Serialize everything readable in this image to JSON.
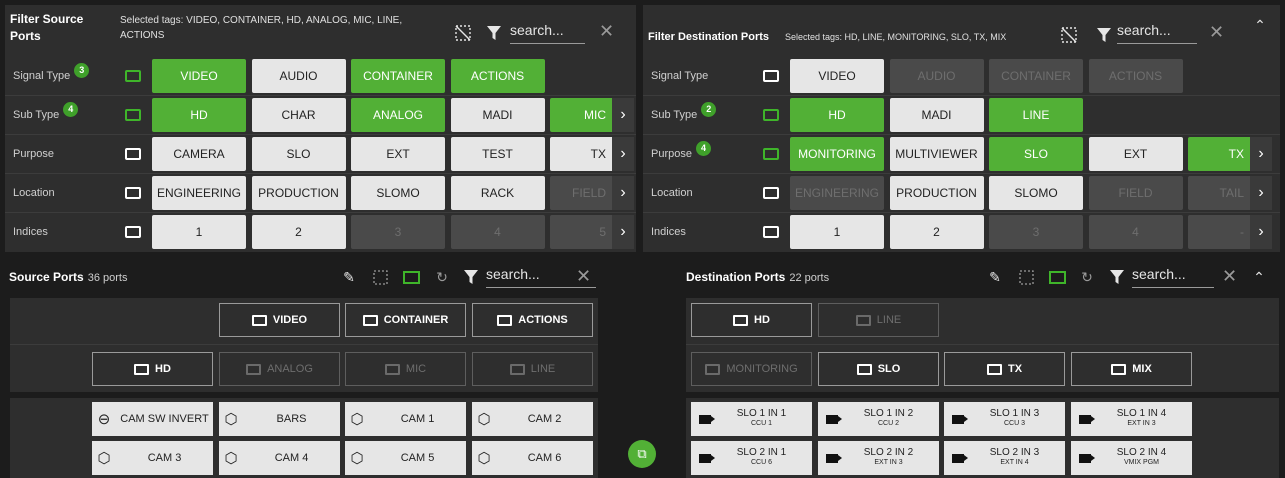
{
  "source_filter": {
    "title": "Filter Source Ports",
    "selected_tags": "Selected tags: VIDEO, CONTAINER, HD, ANALOG, MIC, LINE, ACTIONS",
    "search_placeholder": "search...",
    "rows": [
      {
        "label": "Signal Type",
        "badge": "3",
        "folder_active": true,
        "chips": [
          {
            "t": "VIDEO",
            "s": "g"
          },
          {
            "t": "AUDIO",
            "s": "w"
          },
          {
            "t": "CONTAINER",
            "s": "g"
          },
          {
            "t": "ACTIONS",
            "s": "g"
          }
        ]
      },
      {
        "label": "Sub Type",
        "badge": "4",
        "folder_active": true,
        "chips": [
          {
            "t": "HD",
            "s": "g"
          },
          {
            "t": "CHAR",
            "s": "w"
          },
          {
            "t": "ANALOG",
            "s": "g"
          },
          {
            "t": "MADI",
            "s": "w"
          },
          {
            "t": "MIC",
            "s": "g"
          }
        ]
      },
      {
        "label": "Purpose",
        "badge": "",
        "folder_active": false,
        "chips": [
          {
            "t": "CAMERA",
            "s": "w"
          },
          {
            "t": "SLO",
            "s": "w"
          },
          {
            "t": "EXT",
            "s": "w"
          },
          {
            "t": "TEST",
            "s": "w"
          },
          {
            "t": "TX",
            "s": "w"
          }
        ]
      },
      {
        "label": "Location",
        "badge": "",
        "folder_active": false,
        "chips": [
          {
            "t": "ENGINEERING",
            "s": "w"
          },
          {
            "t": "PRODUCTION",
            "s": "w"
          },
          {
            "t": "SLOMO",
            "s": "w"
          },
          {
            "t": "RACK",
            "s": "w"
          },
          {
            "t": "FIELD",
            "s": "d"
          }
        ]
      },
      {
        "label": "Indices",
        "badge": "",
        "folder_active": false,
        "chips": [
          {
            "t": "1",
            "s": "w"
          },
          {
            "t": "2",
            "s": "w"
          },
          {
            "t": "3",
            "s": "d"
          },
          {
            "t": "4",
            "s": "d"
          },
          {
            "t": "5",
            "s": "d"
          }
        ]
      }
    ]
  },
  "dest_filter": {
    "title": "Filter Destination Ports",
    "selected_tags": "Selected tags: HD, LINE, MONITORING, SLO, TX, MIX",
    "search_placeholder": "search...",
    "rows": [
      {
        "label": "Signal Type",
        "badge": "",
        "folder_active": false,
        "chips": [
          {
            "t": "VIDEO",
            "s": "w"
          },
          {
            "t": "AUDIO",
            "s": "d"
          },
          {
            "t": "CONTAINER",
            "s": "d"
          },
          {
            "t": "ACTIONS",
            "s": "d"
          }
        ]
      },
      {
        "label": "Sub Type",
        "badge": "2",
        "folder_active": true,
        "chips": [
          {
            "t": "HD",
            "s": "g"
          },
          {
            "t": "MADI",
            "s": "w"
          },
          {
            "t": "LINE",
            "s": "g"
          }
        ]
      },
      {
        "label": "Purpose",
        "badge": "4",
        "folder_active": true,
        "chips": [
          {
            "t": "MONITORING",
            "s": "g"
          },
          {
            "t": "MULTIVIEWER",
            "s": "w"
          },
          {
            "t": "SLO",
            "s": "g"
          },
          {
            "t": "EXT",
            "s": "w"
          },
          {
            "t": "TX",
            "s": "g"
          }
        ]
      },
      {
        "label": "Location",
        "badge": "",
        "folder_active": false,
        "chips": [
          {
            "t": "ENGINEERING",
            "s": "d"
          },
          {
            "t": "PRODUCTION",
            "s": "w"
          },
          {
            "t": "SLOMO",
            "s": "w"
          },
          {
            "t": "FIELD",
            "s": "d"
          },
          {
            "t": "TAIL",
            "s": "d"
          }
        ]
      },
      {
        "label": "Indices",
        "badge": "",
        "folder_active": false,
        "chips": [
          {
            "t": "1",
            "s": "w"
          },
          {
            "t": "2",
            "s": "w"
          },
          {
            "t": "3",
            "s": "d"
          },
          {
            "t": "4",
            "s": "d"
          },
          {
            "t": "-",
            "s": "d"
          }
        ]
      }
    ]
  },
  "source_ports": {
    "title": "Source Ports",
    "count": "36 ports",
    "search_placeholder": "search...",
    "group_row1": [
      {
        "t": "VIDEO",
        "dim": false
      },
      {
        "t": "CONTAINER",
        "dim": false
      },
      {
        "t": "ACTIONS",
        "dim": false
      }
    ],
    "group_row2": [
      {
        "t": "HD",
        "dim": false
      },
      {
        "t": "ANALOG",
        "dim": true
      },
      {
        "t": "MIC",
        "dim": true
      },
      {
        "t": "LINE",
        "dim": true
      }
    ],
    "ports": [
      {
        "t": "CAM SW INVERT",
        "icon": "toggle-icon"
      },
      {
        "t": "BARS",
        "icon": "cube-icon"
      },
      {
        "t": "CAM 1",
        "icon": "cube-icon"
      },
      {
        "t": "CAM 2",
        "icon": "cube-icon"
      },
      {
        "t": "CAM 3",
        "icon": "cube-icon"
      },
      {
        "t": "CAM 4",
        "icon": "cube-icon"
      },
      {
        "t": "CAM 5",
        "icon": "cube-icon"
      },
      {
        "t": "CAM 6",
        "icon": "cube-icon"
      }
    ]
  },
  "dest_ports": {
    "title": "Destination Ports",
    "count": "22 ports",
    "search_placeholder": "search...",
    "group_row1": [
      {
        "t": "HD",
        "dim": false
      },
      {
        "t": "LINE",
        "dim": true
      }
    ],
    "group_row2": [
      {
        "t": "MONITORING",
        "dim": true
      },
      {
        "t": "SLO",
        "dim": false
      },
      {
        "t": "TX",
        "dim": false
      },
      {
        "t": "MIX",
        "dim": false
      }
    ],
    "ports": [
      {
        "t": "SLO 1 IN 1",
        "s": "CCU 1"
      },
      {
        "t": "SLO 1 IN 2",
        "s": "CCU 2"
      },
      {
        "t": "SLO 1 IN 3",
        "s": "CCU 3"
      },
      {
        "t": "SLO 1 IN 4",
        "s": "EXT IN 3"
      },
      {
        "t": "SLO 2 IN 1",
        "s": "CCU 6"
      },
      {
        "t": "SLO 2 IN 2",
        "s": "EXT IN 3"
      },
      {
        "t": "SLO 2 IN 3",
        "s": "EXT IN 4"
      },
      {
        "t": "SLO 2 IN 4",
        "s": "VMIX PGM"
      }
    ]
  },
  "colors": {
    "active_green": "#52b036",
    "chip_light": "#e6e6e6",
    "chip_disabled": "#4a4a4a"
  }
}
